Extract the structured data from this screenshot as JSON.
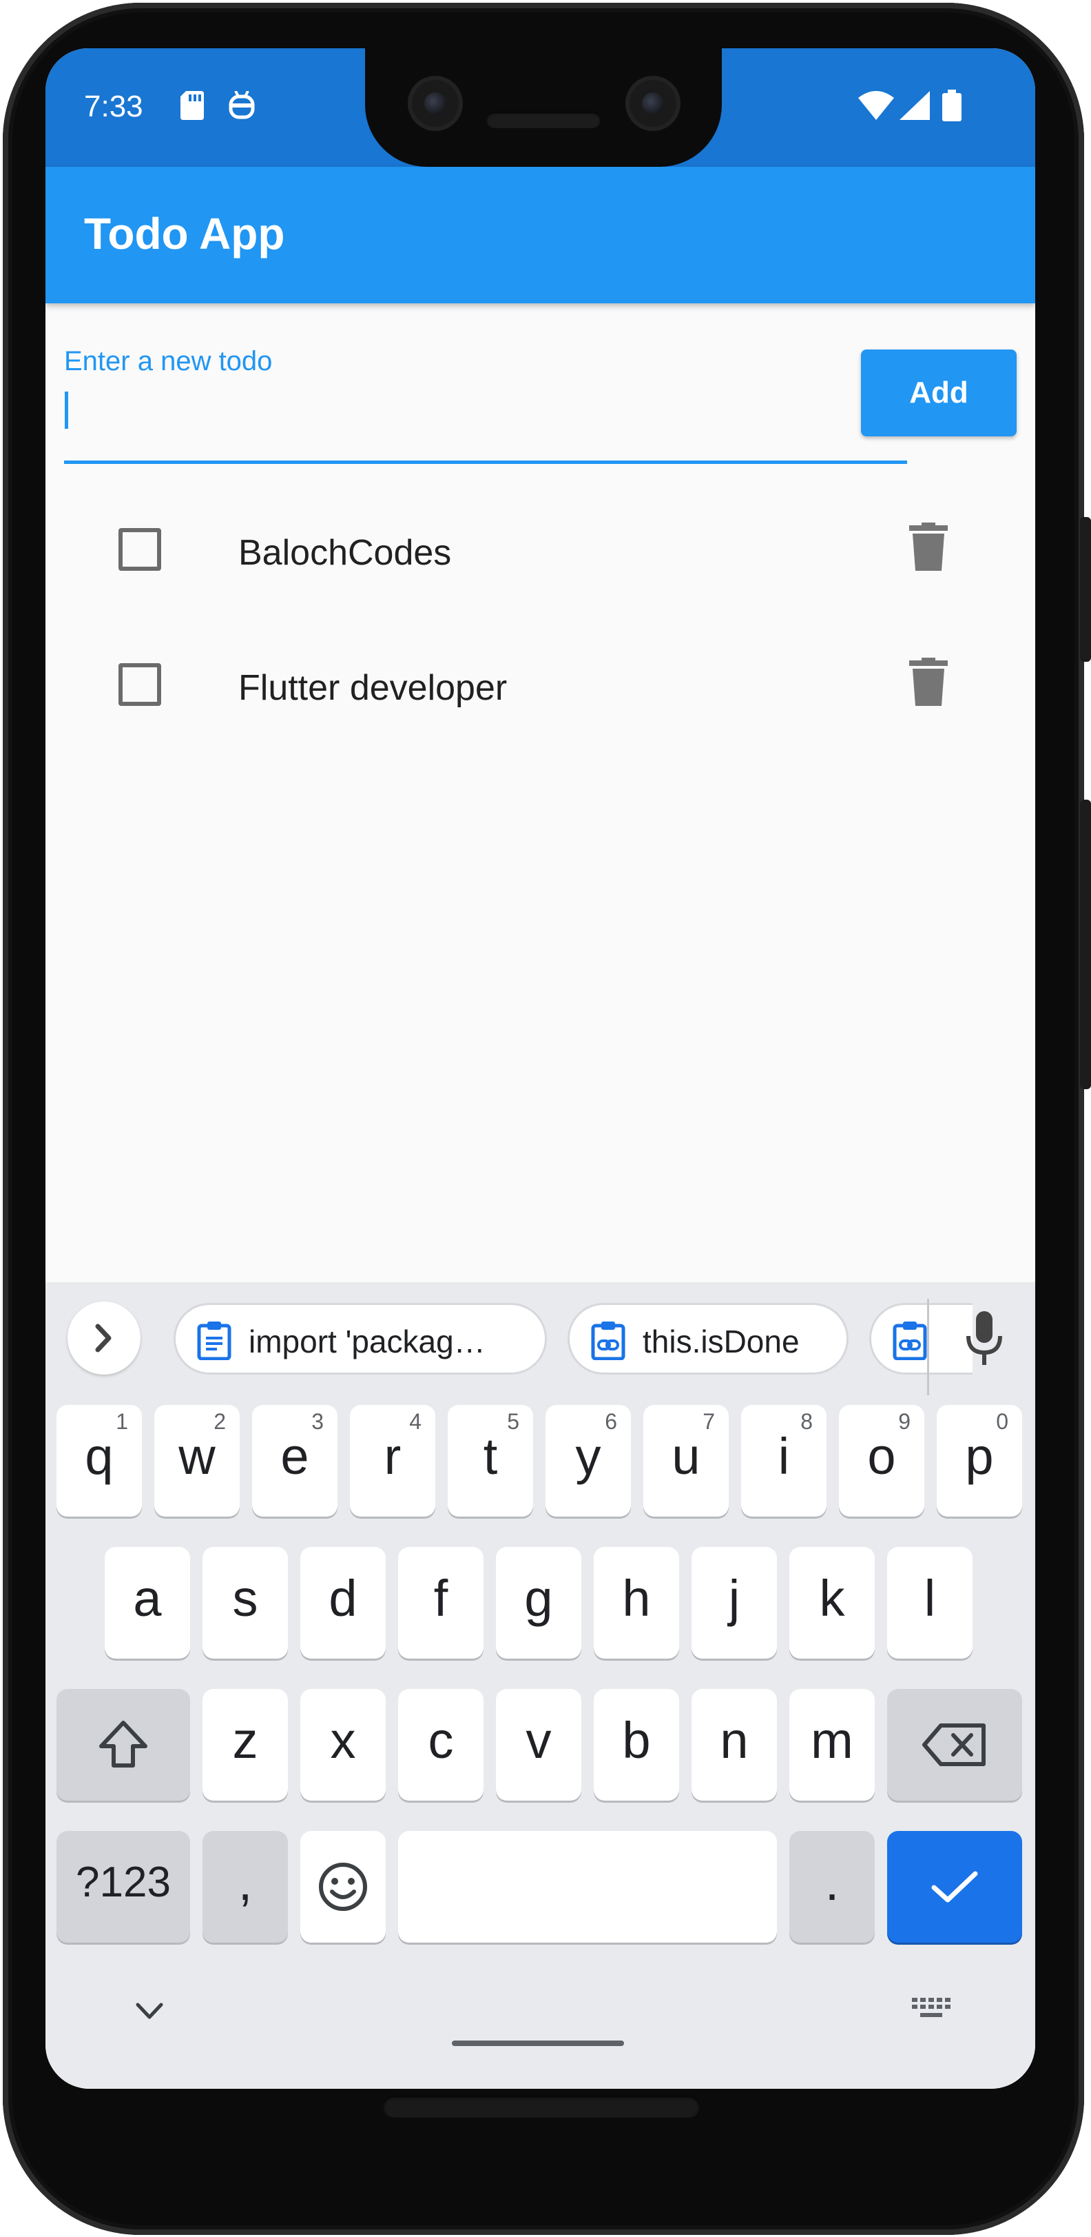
{
  "status_bar": {
    "time": "7:33",
    "icons": [
      "sd-card-icon",
      "robot-icon",
      "wifi-icon",
      "signal-icon",
      "battery-icon"
    ],
    "color": "#1976d2"
  },
  "app_bar": {
    "title": "Todo App",
    "color": "#2196f3"
  },
  "input": {
    "label": "Enter a new todo",
    "value": "",
    "add_label": "Add"
  },
  "todos": [
    {
      "text": "BalochCodes",
      "done": false
    },
    {
      "text": "Flutter developer",
      "done": false
    }
  ],
  "keyboard": {
    "suggestions": [
      {
        "text": "import 'packag…",
        "icon": "clipboard-icon"
      },
      {
        "text": "this.isDone",
        "icon": "clipboard-link-icon"
      },
      {
        "text": "",
        "icon": "clipboard-link-icon"
      }
    ],
    "row1": [
      {
        "key": "q",
        "hint": "1"
      },
      {
        "key": "w",
        "hint": "2"
      },
      {
        "key": "e",
        "hint": "3"
      },
      {
        "key": "r",
        "hint": "4"
      },
      {
        "key": "t",
        "hint": "5"
      },
      {
        "key": "y",
        "hint": "6"
      },
      {
        "key": "u",
        "hint": "7"
      },
      {
        "key": "i",
        "hint": "8"
      },
      {
        "key": "o",
        "hint": "9"
      },
      {
        "key": "p",
        "hint": "0"
      }
    ],
    "row2": [
      "a",
      "s",
      "d",
      "f",
      "g",
      "h",
      "j",
      "k",
      "l"
    ],
    "row3": [
      "z",
      "x",
      "c",
      "v",
      "b",
      "n",
      "m"
    ],
    "symbols_label": "?123",
    "comma": ",",
    "period": ".",
    "accent_color": "#1a73e8"
  }
}
